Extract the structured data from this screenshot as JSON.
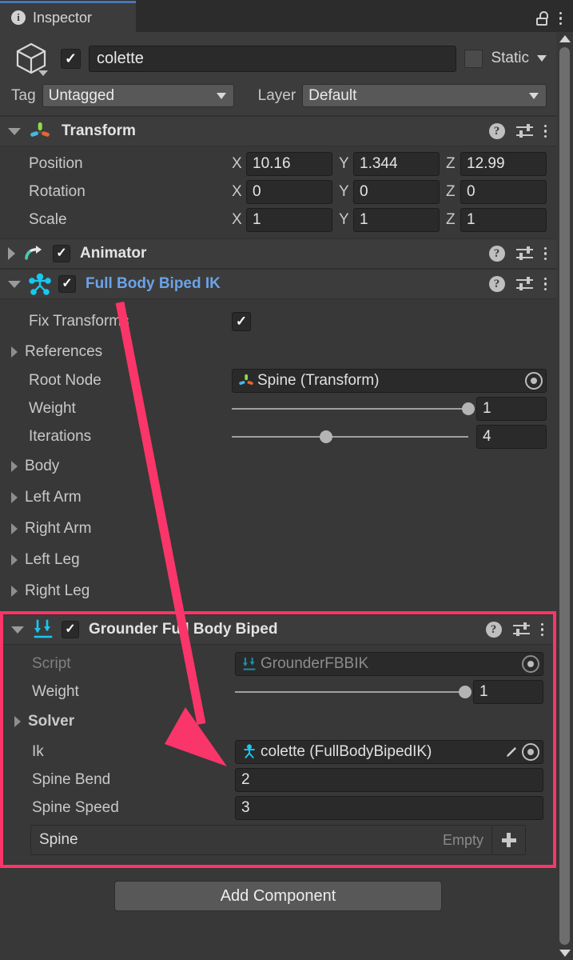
{
  "window": {
    "tab_label": "Inspector",
    "tab_icon": "info-icon",
    "lock_icon": "lock-icon",
    "menu_icon": "kebab-menu-icon",
    "accent_tab": "#4a78b8"
  },
  "object_header": {
    "prefab_icon": "cube-icon",
    "enabled": true,
    "name": "colette",
    "static_checked": false,
    "static_label": "Static",
    "tag_label": "Tag",
    "tag_value": "Untagged",
    "layer_label": "Layer",
    "layer_value": "Default"
  },
  "components": [
    {
      "name": "Transform",
      "icon": "transform-gizmo-icon",
      "expanded": true,
      "has_enable_toggle": false,
      "link_style": false,
      "rows": [
        {
          "type": "vector3",
          "label": "Position",
          "x": "10.16",
          "y": "1.344",
          "z": "12.99"
        },
        {
          "type": "vector3",
          "label": "Rotation",
          "x": "0",
          "y": "0",
          "z": "0"
        },
        {
          "type": "vector3",
          "label": "Scale",
          "x": "1",
          "y": "1",
          "z": "1"
        }
      ]
    },
    {
      "name": "Animator",
      "icon": "animator-arrow-icon",
      "expanded": false,
      "has_enable_toggle": true,
      "enabled": true,
      "link_style": false,
      "rows": []
    },
    {
      "name": "Full Body Biped IK",
      "icon": "biped-ik-icon",
      "expanded": true,
      "has_enable_toggle": true,
      "enabled": true,
      "link_style": true,
      "rows": [
        {
          "type": "checkbox",
          "label": "Fix Transforms",
          "checked": true
        },
        {
          "type": "foldout",
          "label": "References",
          "open": false
        },
        {
          "type": "object",
          "label": "Root Node",
          "value": "Spine (Transform)",
          "value_icon": "transform-gizmo-icon",
          "dim": false,
          "has_pencil": false
        },
        {
          "type": "slider",
          "label": "Weight",
          "value": "1",
          "fill": 100
        },
        {
          "type": "slider",
          "label": "Iterations",
          "value": "4",
          "fill": 40
        },
        {
          "type": "foldout",
          "label": "Body",
          "open": false
        },
        {
          "type": "foldout",
          "label": "Left Arm",
          "open": false
        },
        {
          "type": "foldout",
          "label": "Right Arm",
          "open": false
        },
        {
          "type": "foldout",
          "label": "Left Leg",
          "open": false
        },
        {
          "type": "foldout",
          "label": "Right Leg",
          "open": false
        }
      ]
    },
    {
      "name": "Grounder Full Body Biped",
      "icon": "grounder-arrows-icon",
      "expanded": true,
      "has_enable_toggle": true,
      "enabled": true,
      "link_style": false,
      "highlighted": true,
      "rows": [
        {
          "type": "object",
          "label": "Script",
          "value": "GrounderFBBIK",
          "value_icon": "grounder-arrows-icon",
          "dim": true,
          "has_pencil": false
        },
        {
          "type": "slider",
          "label": "Weight",
          "value": "1",
          "fill": 100
        },
        {
          "type": "foldout",
          "label": "Solver",
          "open": false,
          "bold": true
        },
        {
          "type": "object",
          "label": "Ik",
          "value": "colette (FullBodyBipedIK)",
          "value_icon": "biped-ik-icon",
          "dim": false,
          "has_pencil": true
        },
        {
          "type": "number",
          "label": "Spine Bend",
          "value": "2"
        },
        {
          "type": "number",
          "label": "Spine Speed",
          "value": "3"
        },
        {
          "type": "list",
          "label": "Spine",
          "empty_label": "Empty",
          "add_icon": "plus-icon"
        }
      ]
    }
  ],
  "footer": {
    "add_component_label": "Add Component"
  },
  "annotation": {
    "color": "#fa3569",
    "highlight_color": "#fa3569",
    "kind": "arrow-pointing-to-grounder-component"
  },
  "scrollbar": {
    "up_icon": "scroll-up-arrow-icon",
    "down_icon": "scroll-down-arrow-icon"
  }
}
